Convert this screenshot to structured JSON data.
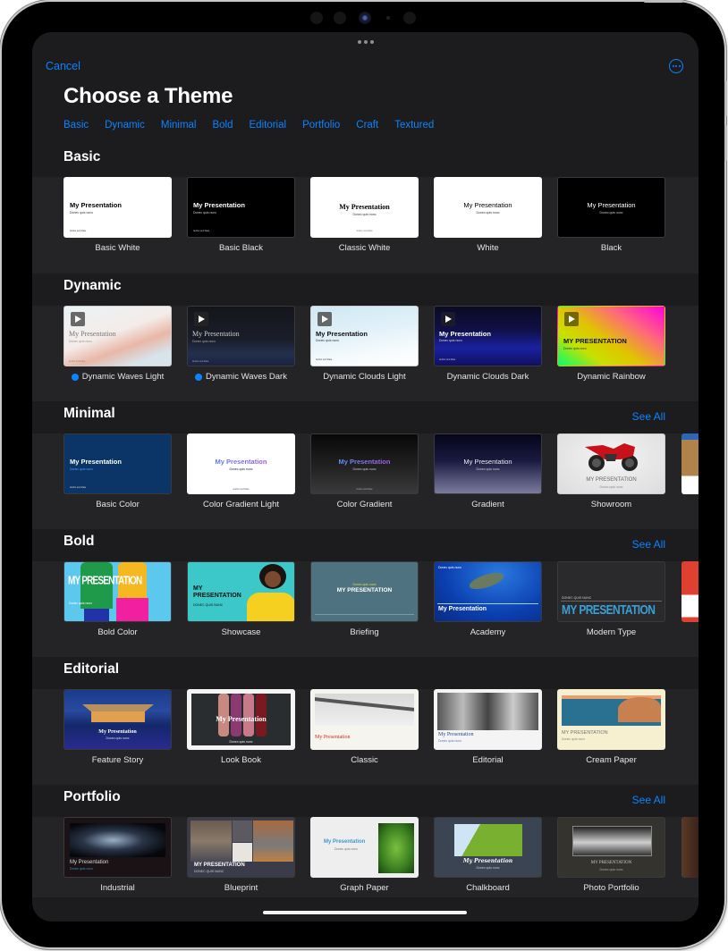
{
  "header": {
    "cancel_label": "Cancel",
    "more_icon": "ellipsis-circle-icon",
    "title": "Choose a Theme",
    "categories": [
      "Basic",
      "Dynamic",
      "Minimal",
      "Bold",
      "Editorial",
      "Portfolio",
      "Craft",
      "Textured"
    ]
  },
  "colors": {
    "accent": "#0a84ff",
    "background": "#1c1c1e",
    "band": "#242426",
    "text": "#ffffff"
  },
  "sections": [
    {
      "title": "Basic",
      "see_all": null,
      "themes": [
        {
          "name": "Basic White",
          "thumb_title": "My Presentation",
          "thumb_sub": "Donec quis nunc",
          "thumb_foot": "Author and Date"
        },
        {
          "name": "Basic Black",
          "thumb_title": "My Presentation",
          "thumb_sub": "Donec quis nunc",
          "thumb_foot": "Author and Date"
        },
        {
          "name": "Classic White",
          "thumb_title": "My Presentation",
          "thumb_sub": "Donec quis nunc",
          "thumb_foot": "Author and Date"
        },
        {
          "name": "White",
          "thumb_title": "My Presentation",
          "thumb_sub": "Donec quis nunc"
        },
        {
          "name": "Black",
          "thumb_title": "My Presentation",
          "thumb_sub": "Donec quis nunc"
        }
      ]
    },
    {
      "title": "Dynamic",
      "see_all": null,
      "themes": [
        {
          "name": "Dynamic Waves Light",
          "new_badge": true,
          "thumb_title": "My Presentation",
          "thumb_sub": "Donec quis nunc",
          "thumb_foot": "Author and Date"
        },
        {
          "name": "Dynamic Waves Dark",
          "new_badge": true,
          "thumb_title": "My Presentation",
          "thumb_sub": "Donec quis nunc",
          "thumb_foot": "Author and Date"
        },
        {
          "name": "Dynamic Clouds Light",
          "thumb_title": "My Presentation",
          "thumb_sub": "Donec quis nunc",
          "thumb_foot": "Author and Date"
        },
        {
          "name": "Dynamic Clouds Dark",
          "thumb_title": "My Presentation",
          "thumb_sub": "Donec quis nunc",
          "thumb_foot": "Author and Date"
        },
        {
          "name": "Dynamic Rainbow",
          "thumb_title": "MY PRESENTATION",
          "thumb_sub": "Donec quis nunc"
        }
      ]
    },
    {
      "title": "Minimal",
      "see_all": "See All",
      "themes": [
        {
          "name": "Basic Color",
          "thumb_title": "My Presentation",
          "thumb_sub": "Donec quis nunc",
          "thumb_foot": "Author and Date"
        },
        {
          "name": "Color Gradient Light",
          "thumb_title": "My Presentation",
          "thumb_sub": "Donec quis nunc",
          "thumb_foot": "Author and Date"
        },
        {
          "name": "Color Gradient",
          "thumb_title": "My Presentation",
          "thumb_sub": "Donec quis nunc",
          "thumb_foot": "Author and Date"
        },
        {
          "name": "Gradient",
          "thumb_title": "My Presentation",
          "thumb_sub": "Donec quis nunc"
        },
        {
          "name": "Showroom",
          "thumb_title": "MY PRESENTATION",
          "thumb_sub": "Donec quis nunc"
        }
      ]
    },
    {
      "title": "Bold",
      "see_all": "See All",
      "themes": [
        {
          "name": "Bold Color",
          "thumb_title": "MY PRESENTATION",
          "thumb_sub": "Donec quis nunc"
        },
        {
          "name": "Showcase",
          "thumb_title": "MY PRESENTATION",
          "thumb_sub": "DONEC QUIS NUNC"
        },
        {
          "name": "Briefing",
          "thumb_title": "MY PRESENTATION",
          "thumb_sub": "Donec quis nunc"
        },
        {
          "name": "Academy",
          "thumb_title": "My Presentation",
          "thumb_sub": "Donec quis nunc"
        },
        {
          "name": "Modern Type",
          "thumb_title": "MY PRESENTATION",
          "thumb_sub": "DONEC QUIS NUNC"
        }
      ]
    },
    {
      "title": "Editorial",
      "see_all": null,
      "themes": [
        {
          "name": "Feature Story",
          "thumb_title": "My Presentation",
          "thumb_sub": "Donec quis nunc"
        },
        {
          "name": "Look Book",
          "thumb_title": "My Presentation",
          "thumb_sub": "Donec quis nunc"
        },
        {
          "name": "Classic",
          "thumb_title": "My Presentation"
        },
        {
          "name": "Editorial",
          "thumb_title": "My Presentation",
          "thumb_sub": "Donec quis nunc"
        },
        {
          "name": "Cream Paper",
          "thumb_title": "MY PRESENTATION",
          "thumb_sub": "Donec quis nunc"
        }
      ]
    },
    {
      "title": "Portfolio",
      "see_all": "See All",
      "themes": [
        {
          "name": "Industrial",
          "thumb_title": "My Presentation",
          "thumb_sub": "Donec quis nunc"
        },
        {
          "name": "Blueprint",
          "thumb_title": "MY PRESENTATION",
          "thumb_sub": "DONEC QUIS NUNC"
        },
        {
          "name": "Graph Paper",
          "thumb_title": "My Presentation",
          "thumb_sub": "Donec quis nunc"
        },
        {
          "name": "Chalkboard",
          "thumb_title": "My Presentation",
          "thumb_sub": "Donec quis nunc"
        },
        {
          "name": "Photo Portfolio",
          "thumb_title": "MY PRESENTATION",
          "thumb_sub": "Donec quis nunc"
        }
      ]
    }
  ]
}
